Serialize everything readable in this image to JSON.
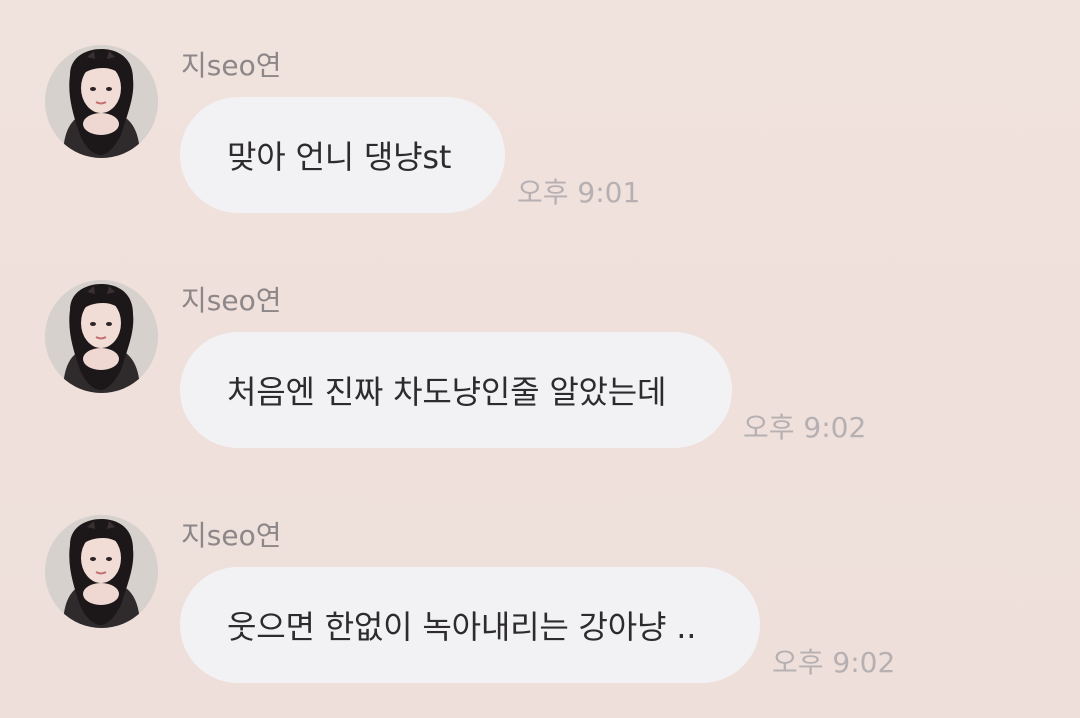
{
  "messages": [
    {
      "sender": "지seo연",
      "text": "맞아 언니 댕냥st",
      "time": "오후 9:01"
    },
    {
      "sender": "지seo연",
      "text": "처음엔 진짜 차도냥인줄 알았는데",
      "time": "오후 9:02"
    },
    {
      "sender": "지seo연",
      "text": "웃으면 한없이 녹아내리는 강아냥 ..",
      "time": "오후 9:02"
    }
  ],
  "colors": {
    "background": "#efe0dc",
    "bubble": "#f2f2f4",
    "sender_text": "#8d8789",
    "message_text": "#2d2b2e",
    "timestamp_text": "#b6b0b2"
  },
  "icons": {
    "avatar": "profile-photo"
  }
}
